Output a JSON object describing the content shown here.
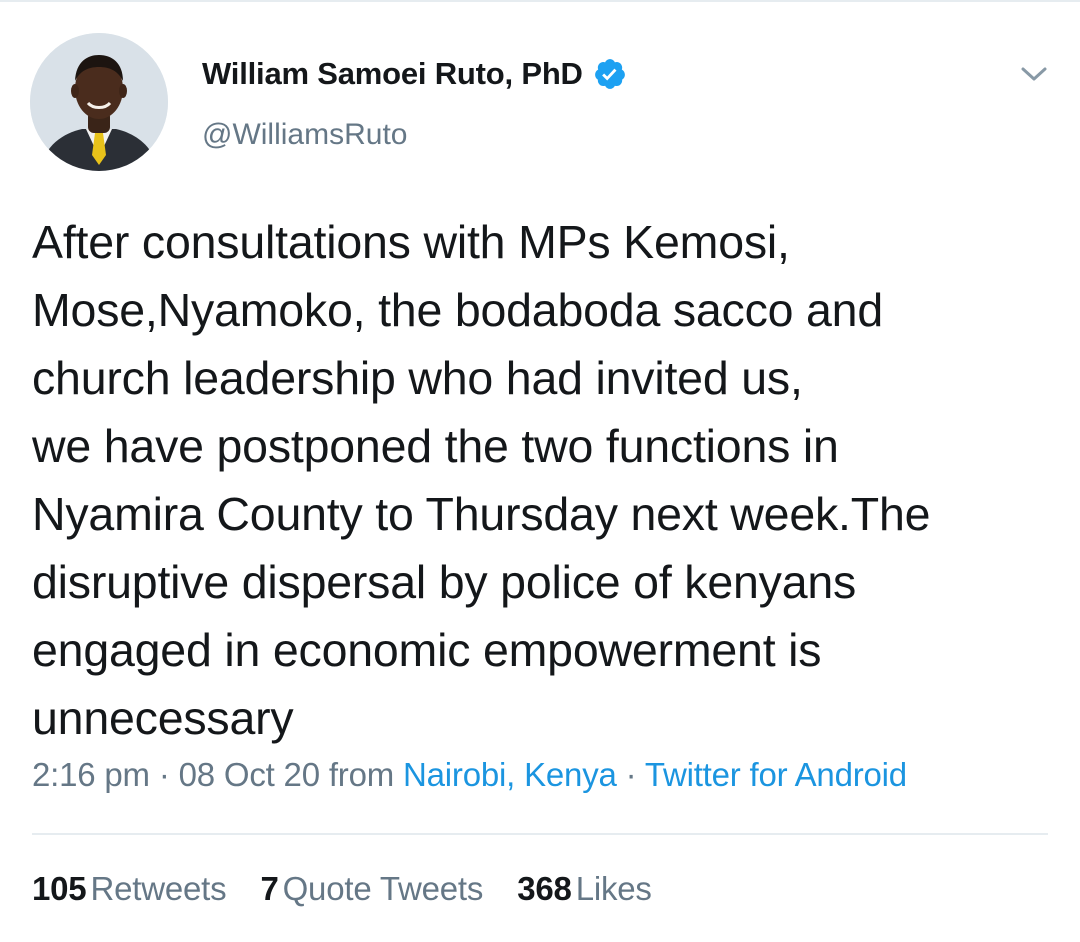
{
  "author": {
    "display_name": "William Samoei Ruto, PhD",
    "handle": "@WilliamsRuto",
    "verified": true
  },
  "tweet": {
    "text": "After consultations with MPs Kemosi,\nMose,Nyamoko, the bodaboda sacco and\nchurch leadership who had invited us,\nwe have postponed the two functions in\nNyamira County to Thursday next week.The\ndisruptive dispersal by police of kenyans\nengaged in economic empowerment is\nunnecessary"
  },
  "meta": {
    "time": "2:16 pm",
    "sep1": "·",
    "date": "08 Oct 20",
    "from_label": "from",
    "location": "Nairobi, Kenya",
    "sep2": "·",
    "source": "Twitter for Android"
  },
  "stats": {
    "retweets_count": "105",
    "retweets_label": "Retweets",
    "quotes_count": "7",
    "quotes_label": "Quote Tweets",
    "likes_count": "368",
    "likes_label": "Likes"
  },
  "icons": {
    "verified": "verified-badge-icon",
    "menu": "chevron-down-icon"
  },
  "colors": {
    "link": "#1b95e0",
    "secondary_text": "#657786",
    "verified": "#1da1f2",
    "divider": "#e6ecf0"
  }
}
